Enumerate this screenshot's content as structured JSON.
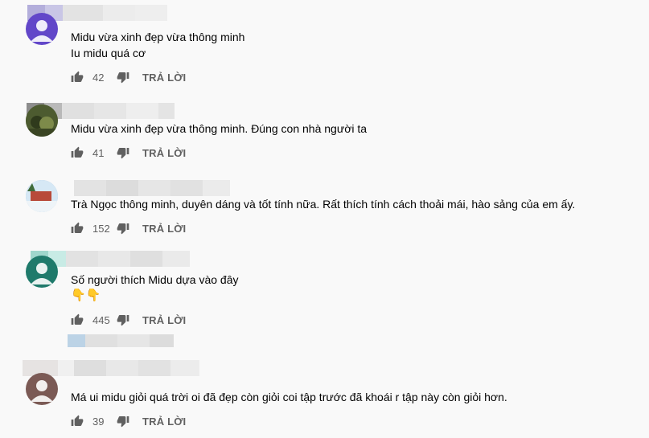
{
  "comments": [
    {
      "text_lines": [
        "Midu vừa xinh đẹp vừa thông minh",
        "Iu midu quá cơ"
      ],
      "likes": "42",
      "reply_label": "TRẢ LỜI",
      "avatar_color": "#6247c9"
    },
    {
      "text_lines": [
        "Midu vừa xinh đẹp vừa thông minh. Đúng con nhà người ta"
      ],
      "likes": "41",
      "reply_label": "TRẢ LỜI",
      "avatar_color": "#5d6b3c"
    },
    {
      "text_lines": [
        "Trà Ngọc thông minh, duyên dáng và tốt tính nữa. Rất thích tính cách thoải mái, hào sảng của em ấy."
      ],
      "likes": "152",
      "reply_label": "TRẢ LỜI",
      "avatar_color": "#8fb8d8"
    },
    {
      "text_lines": [
        "Số người thích Midu dựa vào đây"
      ],
      "emoji": "👇👇",
      "likes": "445",
      "reply_label": "TRẢ LỜI",
      "avatar_color": "#1f7a6b"
    },
    {
      "text_lines": [
        "Má ui midu giỏi quá trời oi đã đẹp còn giỏi coi tập trước đã khoái r tập này còn  giỏi hơn."
      ],
      "likes": "39",
      "reply_label": "TRẢ LỜI",
      "avatar_color": "#7b5a55"
    }
  ],
  "icons": {
    "like": "thumbs-up-icon",
    "dislike": "thumbs-down-icon"
  }
}
